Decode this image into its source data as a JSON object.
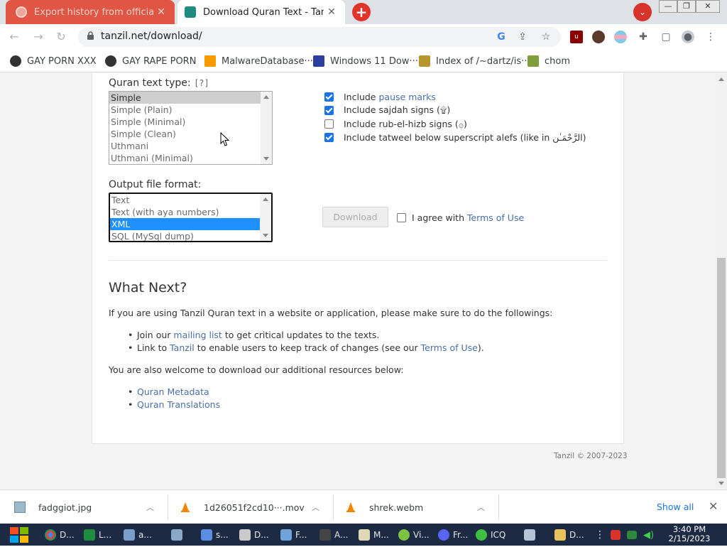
{
  "browser": {
    "tabs": [
      {
        "title": "Export history from official ICQ",
        "active": false
      },
      {
        "title": "Download Quran Text - Tanzil",
        "active": true
      }
    ],
    "new_tab_label": "+",
    "url": "tanzil.net/download/",
    "bookmarks": [
      "GAY PORN XXX",
      "GAY RAPE PORN",
      "MalwareDatabase···",
      "Windows 11 Dow···",
      "Index of /~dartz/is···",
      "chom"
    ]
  },
  "page": {
    "text_type": {
      "label": "Quran text type:",
      "help": "[?]",
      "options": [
        "Simple",
        "Simple (Plain)",
        "Simple (Minimal)",
        "Simple (Clean)",
        "Uthmani",
        "Uthmani (Minimal)"
      ],
      "selected": "Simple"
    },
    "options": {
      "pause_prefix": "Include ",
      "pause_link": "pause marks",
      "pause_checked": true,
      "sajdah": "Include sajdah signs (۩)",
      "sajdah_checked": true,
      "rub": "Include rub-el-hizb signs (۞)",
      "rub_checked": false,
      "tatweel": "Include tatweel below superscript alefs (like in الرَّحْمَـٰن)",
      "tatweel_checked": true
    },
    "output_format": {
      "label": "Output file format:",
      "options": [
        "Text",
        "Text (with aya numbers)",
        "XML",
        "SQL (MySql dump)"
      ],
      "selected": "XML"
    },
    "download_button": "Download",
    "agree_prefix": "I agree with ",
    "agree_link": "Terms of Use",
    "agree_checked": false,
    "what_next": {
      "heading": "What Next?",
      "intro": "If you are using Tanzil Quran text in a website or application, please make sure to do the followings:",
      "b1_prefix": "Join our ",
      "b1_link": "mailing list",
      "b1_suffix": " to get critical updates to the texts.",
      "b2_prefix": "Link to ",
      "b2_link": "Tanzil",
      "b2_mid": " to enable users to keep track of changes (see our ",
      "b2_link2": "Terms of Use",
      "b2_suffix": ").",
      "resources_intro": "You are also welcome to download our additional resources below:",
      "resources": [
        "Quran Metadata",
        "Quran Translations"
      ]
    },
    "footer": "Tanzil © 2007-2023"
  },
  "downloads": {
    "items": [
      "fadggiot.jpg",
      "1d26051f2cd10···.mov",
      "shrek.webm"
    ],
    "show_all": "Show all"
  },
  "taskbar": {
    "items": [
      "D...",
      "L...",
      "a...",
      "",
      "s...",
      "D...",
      "F...",
      "A...",
      "M...",
      "Vi...",
      "Fr...",
      "ICQ",
      "",
      "D..."
    ],
    "time": "3:40 PM",
    "date": "2/15/2023"
  },
  "colors": {
    "link": "#4a6fa5",
    "checkbox_checked": "#1a73e8",
    "list_selected": "#1e90ff",
    "inactive_tab": "#e05544",
    "taskbar": "#1c2a44"
  }
}
